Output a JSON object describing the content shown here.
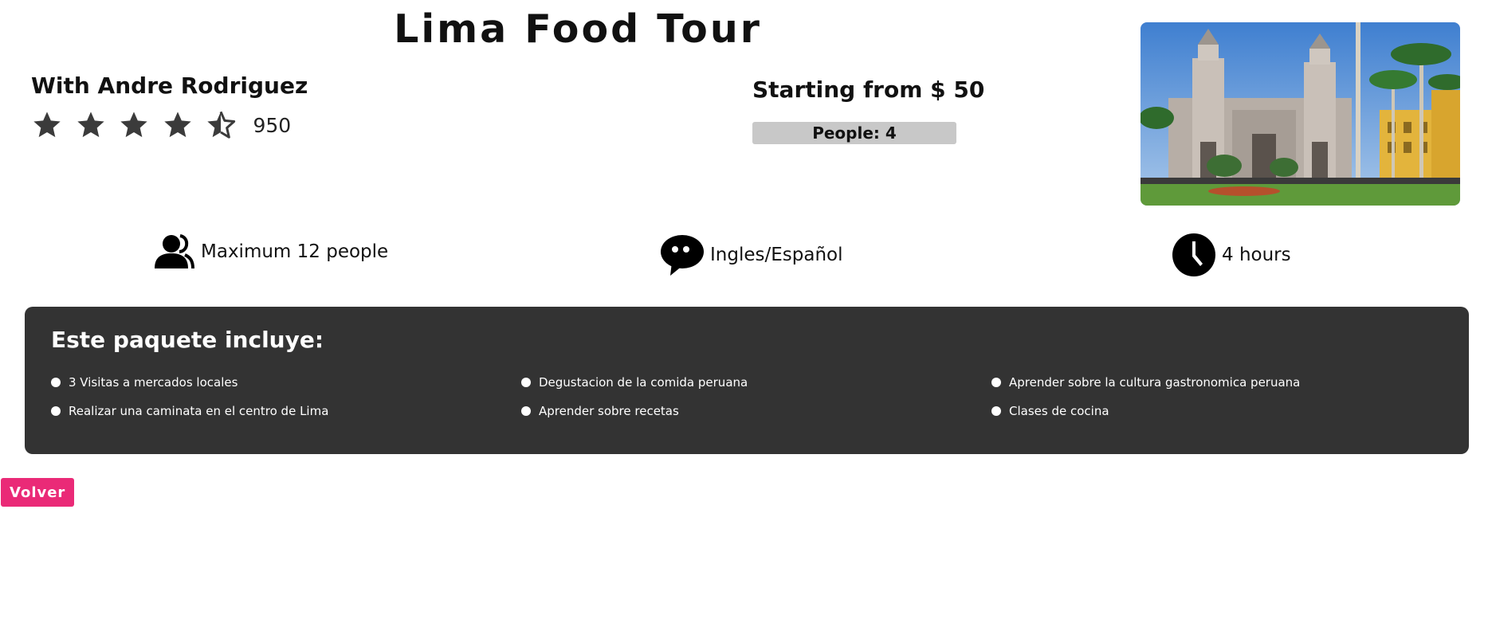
{
  "tour": {
    "title": "Lima Food Tour",
    "guide": "With Andre Rodriguez",
    "rating_stars": 4.5,
    "review_count": "950",
    "price": "Starting from $ 50",
    "people": "People: 4",
    "photo_icon": "cathedral-photo"
  },
  "features": {
    "max_people": "Maximum 12 people",
    "languages": "Ingles/Español",
    "duration": "4 hours"
  },
  "includes": {
    "title": "Este paquete incluye:",
    "items": [
      "3 Visitas a mercados locales",
      "Degustacion de la comida peruana",
      "Aprender sobre la cultura gastronomica peruana",
      "Realizar una caminata en el centro de Lima",
      "Aprender sobre recetas",
      "Clases de cocina"
    ]
  },
  "actions": {
    "back_label": "Volver"
  },
  "colors": {
    "panel_bg": "#333333",
    "accent": "#ea2a77",
    "people_bar": "#c8c8c8",
    "star": "#3b3b3b"
  }
}
